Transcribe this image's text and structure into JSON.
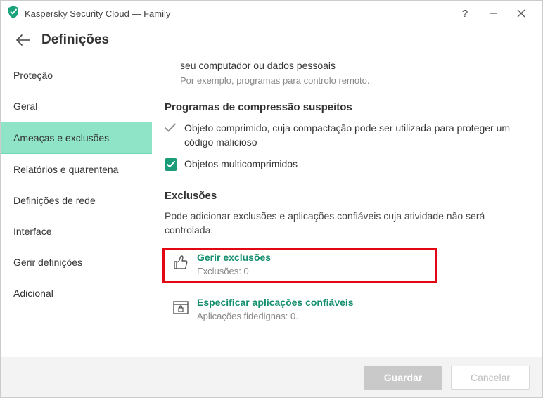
{
  "titlebar": {
    "app_title": "Kaspersky Security Cloud — Family"
  },
  "header": {
    "page_title": "Definições"
  },
  "sidebar": {
    "items": [
      {
        "label": "Proteção"
      },
      {
        "label": "Geral"
      },
      {
        "label": "Ameaças e exclusões"
      },
      {
        "label": "Relatórios e quarentena"
      },
      {
        "label": "Definições de rede"
      },
      {
        "label": "Interface"
      },
      {
        "label": "Gerir definições"
      },
      {
        "label": "Adicional"
      }
    ],
    "active_index": 2
  },
  "content": {
    "top_line": "seu computador ou dados pessoais",
    "top_example": "Por exemplo, programas para controlo remoto.",
    "section_compress_title": "Programas de compressão suspeitos",
    "check1_label": "Objeto comprimido, cuja compactação pode ser utilizada para proteger um código malicioso",
    "check2_label": "Objetos multicomprimidos",
    "section_exclusions_title": "Exclusões",
    "exclusions_desc": "Pode adicionar exclusões e aplicações confiáveis cuja atividade não será controlada.",
    "action1_title": "Gerir exclusões",
    "action1_sub": "Exclusões: 0.",
    "action2_title": "Especificar aplicações confiáveis",
    "action2_sub": "Aplicações fidedignas: 0."
  },
  "footer": {
    "save_label": "Guardar",
    "cancel_label": "Cancelar"
  }
}
